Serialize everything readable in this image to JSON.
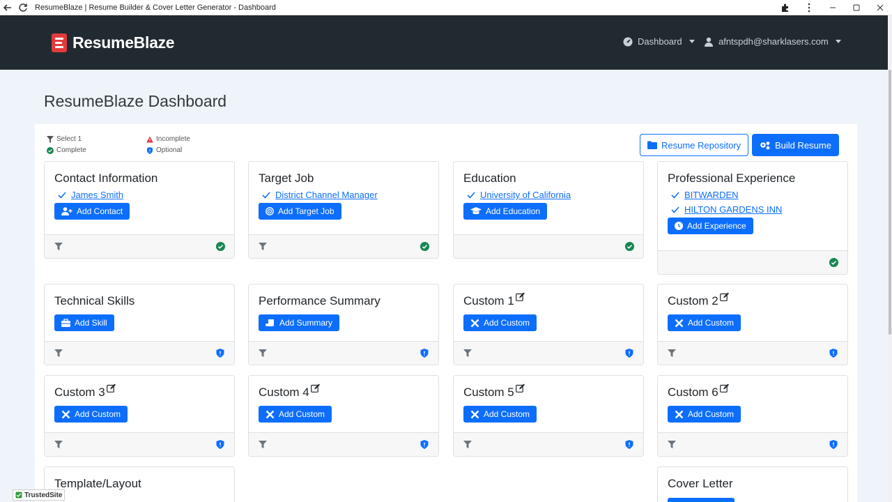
{
  "browser": {
    "title": "ResumeBlaze | Resume Builder & Cover Letter Generator - Dashboard"
  },
  "navbar": {
    "brand": "ResumeBlaze",
    "dashboard_label": "Dashboard",
    "user_email": "afntspdh@sharklasers.com"
  },
  "page": {
    "title": "ResumeBlaze Dashboard"
  },
  "legend": {
    "select": "Select 1",
    "complete": "Complete",
    "incomplete": "Incomplete",
    "optional": "Optional"
  },
  "toolbar": {
    "repository_label": "Resume Repository",
    "build_label": "Build Resume"
  },
  "cards": {
    "contact": {
      "title": "Contact Information",
      "items": [
        "James Smith"
      ],
      "button": "Add Contact"
    },
    "target": {
      "title": "Target Job",
      "items": [
        "District Channel Manager"
      ],
      "button": "Add Target Job"
    },
    "education": {
      "title": "Education",
      "items": [
        "University of California"
      ],
      "button": "Add Education"
    },
    "experience": {
      "title": "Professional Experience",
      "items": [
        "BITWARDEN",
        "HILTON GARDENS INN"
      ],
      "button": "Add Experience"
    },
    "skills": {
      "title": "Technical Skills",
      "button": "Add Skill"
    },
    "summary": {
      "title": "Performance Summary",
      "button": "Add Summary"
    },
    "custom1": {
      "title": "Custom 1",
      "button": "Add Custom"
    },
    "custom2": {
      "title": "Custom 2",
      "button": "Add Custom"
    },
    "custom3": {
      "title": "Custom 3",
      "button": "Add Custom"
    },
    "custom4": {
      "title": "Custom 4",
      "button": "Add Custom"
    },
    "custom5": {
      "title": "Custom 5",
      "button": "Add Custom"
    },
    "custom6": {
      "title": "Custom 6",
      "button": "Add Custom"
    },
    "template": {
      "title": "Template/Layout"
    },
    "cover": {
      "title": "Cover Letter"
    }
  },
  "badge": {
    "trusted": "TrustedSite"
  },
  "colors": {
    "primary": "#0d6efd",
    "navbar": "#222a31",
    "complete": "#198754",
    "incomplete": "#dc3545",
    "optional": "#0d6efd"
  }
}
